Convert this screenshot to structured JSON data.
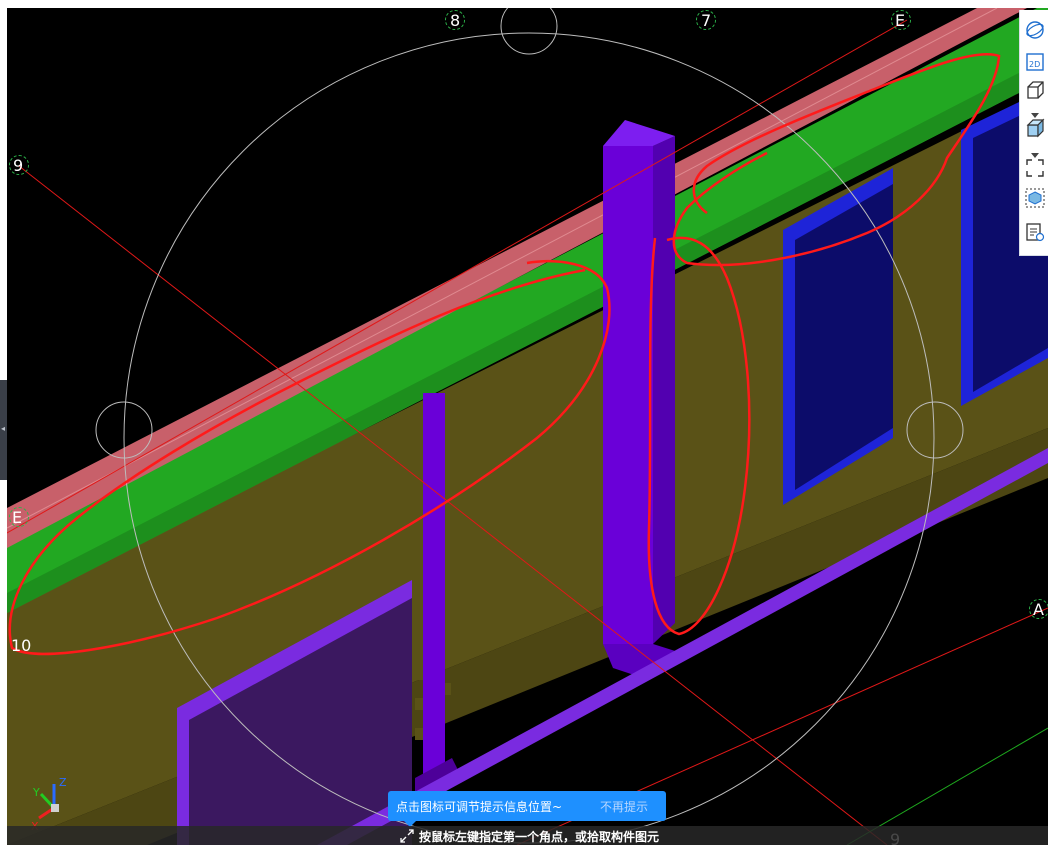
{
  "grid_labels": {
    "top_8": "8",
    "top_7": "7",
    "top_E": "E",
    "left_9": "9",
    "left_E": "E",
    "left_10": "10",
    "right_A": "A",
    "bottom_9": "9"
  },
  "axis_gizmo": {
    "x": "X",
    "y": "Y",
    "z": "Z"
  },
  "tip": {
    "text": "点击图标可调节提示信息位置~",
    "dismiss": "不再提示"
  },
  "status": {
    "prompt": "按鼠标左键指定第一个角点，或拾取构件图元"
  },
  "toolbar": {
    "buttons": [
      "orbit-icon",
      "2d-view-icon",
      "3d-view-icon",
      "solid-box-icon",
      "select-region-icon",
      "component-view-icon",
      "properties-icon"
    ],
    "label_2d": "2D"
  },
  "colors": {
    "background": "#000000",
    "beam_top": "#c8606a",
    "slab": "#22a822",
    "wall": "#5a5217",
    "column": "#6a00d8",
    "window": "#0c0c6a",
    "window_frame": "#1e24d8",
    "markup": "#ff1a1a",
    "tip": "#1e90ff"
  }
}
